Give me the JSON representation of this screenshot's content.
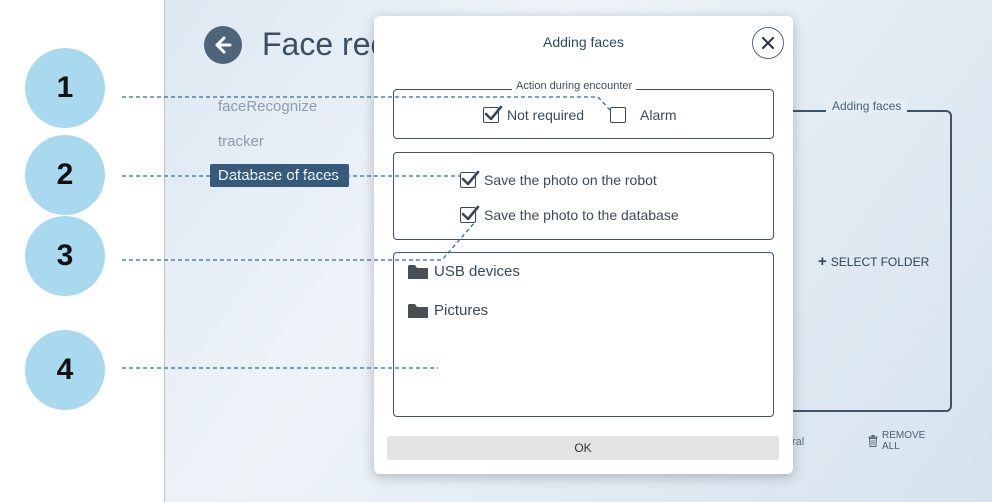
{
  "app": {
    "title": "Face rec",
    "menu": [
      "faceRecognize",
      "tracker",
      "Database of faces"
    ],
    "right_panel": {
      "legend": "Adding faces",
      "select_folder": "SELECT FOLDER",
      "partial_label": "ral",
      "remove_all": [
        "REMOVE",
        "ALL"
      ]
    }
  },
  "dialog": {
    "title": "Adding faces",
    "action_legend": "Action during encounter",
    "actions": [
      {
        "label": "Not required",
        "checked": true
      },
      {
        "label": "Alarm",
        "checked": false
      }
    ],
    "save_options": [
      {
        "label": "Save the photo on the robot",
        "checked": true
      },
      {
        "label": "Save the photo to the database",
        "checked": true
      }
    ],
    "folders": [
      "USB devices",
      "Pictures"
    ],
    "ok_label": "OK"
  },
  "annotations": [
    "1",
    "2",
    "3",
    "4"
  ],
  "colors": {
    "badge": "#a9d9ee",
    "accent": "#365a7c",
    "leader": "#2f6e92"
  }
}
